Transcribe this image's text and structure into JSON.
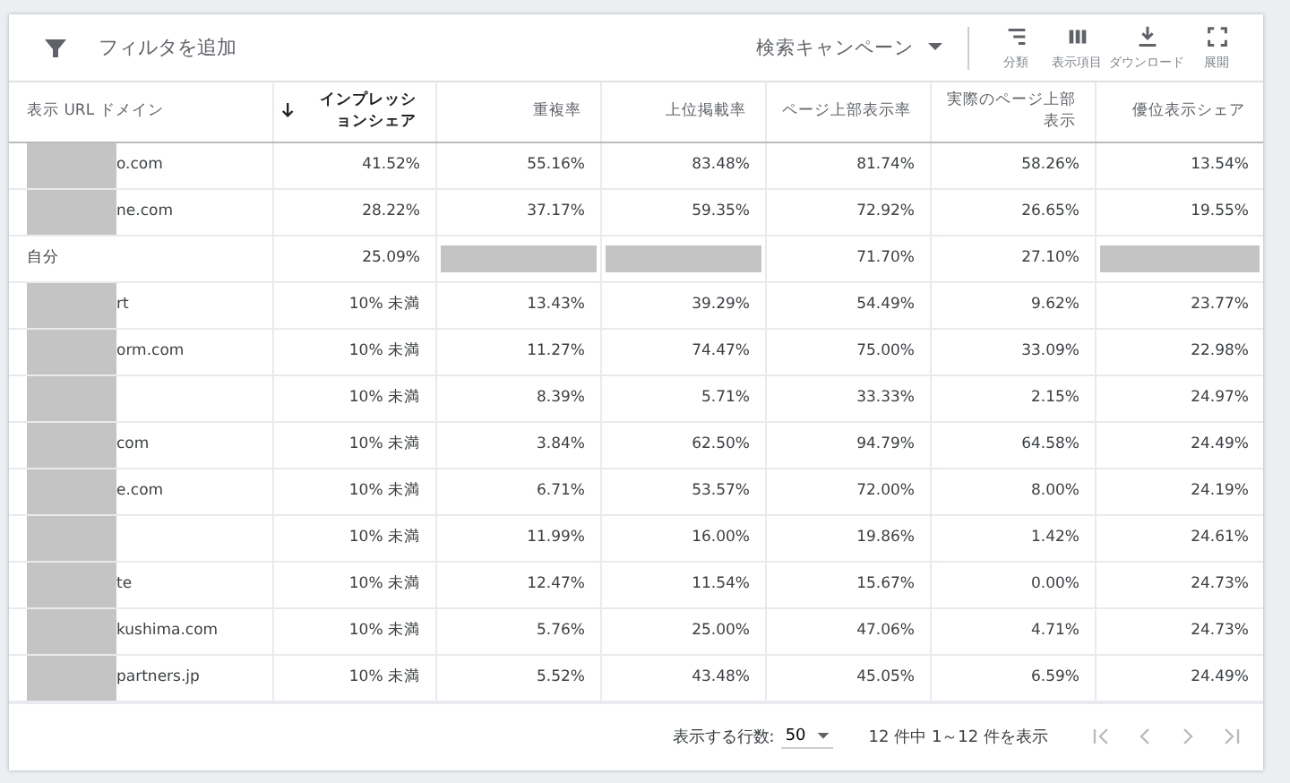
{
  "toolbar": {
    "filter_label": "フィルタを追加",
    "campaign_select": "検索キャンペーン",
    "actions": [
      {
        "kind": "segment",
        "label": "分類"
      },
      {
        "kind": "columns",
        "label": "表示項目"
      },
      {
        "kind": "download",
        "label": "ダウンロード"
      },
      {
        "kind": "expand",
        "label": "展開"
      }
    ]
  },
  "table": {
    "columns": [
      {
        "label": "表示 URL ドメイン",
        "sorted": false
      },
      {
        "label": "インプレッションシェア",
        "sorted": true
      },
      {
        "label": "重複率",
        "sorted": false
      },
      {
        "label": "上位掲載率",
        "sorted": false
      },
      {
        "label": "ページ上部表示率",
        "sorted": false
      },
      {
        "label": "実際のページ上部表示",
        "sorted": false
      },
      {
        "label": "優位表示シェア",
        "sorted": false
      }
    ],
    "rows": [
      {
        "redacted": true,
        "cells": [
          "o.com",
          "41.52%",
          "55.16%",
          "83.48%",
          "81.74%",
          "58.26%",
          "13.54%"
        ]
      },
      {
        "redacted": true,
        "cells": [
          "ne.com",
          "28.22%",
          "37.17%",
          "59.35%",
          "72.92%",
          "26.65%",
          "19.55%"
        ]
      },
      {
        "redacted": false,
        "cells": [
          "自分",
          "25.09%",
          null,
          null,
          "71.70%",
          "27.10%",
          null
        ]
      },
      {
        "redacted": true,
        "cells": [
          "rt",
          "10% 未満",
          "13.43%",
          "39.29%",
          "54.49%",
          "9.62%",
          "23.77%"
        ]
      },
      {
        "redacted": true,
        "cells": [
          "orm.com",
          "10% 未満",
          "11.27%",
          "74.47%",
          "75.00%",
          "33.09%",
          "22.98%"
        ]
      },
      {
        "redacted": true,
        "cells": [
          "",
          "10% 未満",
          "8.39%",
          "5.71%",
          "33.33%",
          "2.15%",
          "24.97%"
        ]
      },
      {
        "redacted": true,
        "cells": [
          "com",
          "10% 未満",
          "3.84%",
          "62.50%",
          "94.79%",
          "64.58%",
          "24.49%"
        ]
      },
      {
        "redacted": true,
        "cells": [
          "e.com",
          "10% 未満",
          "6.71%",
          "53.57%",
          "72.00%",
          "8.00%",
          "24.19%"
        ]
      },
      {
        "redacted": true,
        "cells": [
          "",
          "10% 未満",
          "11.99%",
          "16.00%",
          "19.86%",
          "1.42%",
          "24.61%"
        ]
      },
      {
        "redacted": true,
        "cells": [
          "te",
          "10% 未満",
          "12.47%",
          "11.54%",
          "15.67%",
          "0.00%",
          "24.73%"
        ]
      },
      {
        "redacted": true,
        "cells": [
          "kushima.com",
          "10% 未満",
          "5.76%",
          "25.00%",
          "47.06%",
          "4.71%",
          "24.73%"
        ]
      },
      {
        "redacted": true,
        "cells": [
          "partners.jp",
          "10% 未満",
          "5.52%",
          "43.48%",
          "45.05%",
          "6.59%",
          "24.49%"
        ]
      }
    ]
  },
  "footer": {
    "rows_label": "表示する行数:",
    "rows_value": "50",
    "range": "12 件中 1～12 件を表示"
  }
}
